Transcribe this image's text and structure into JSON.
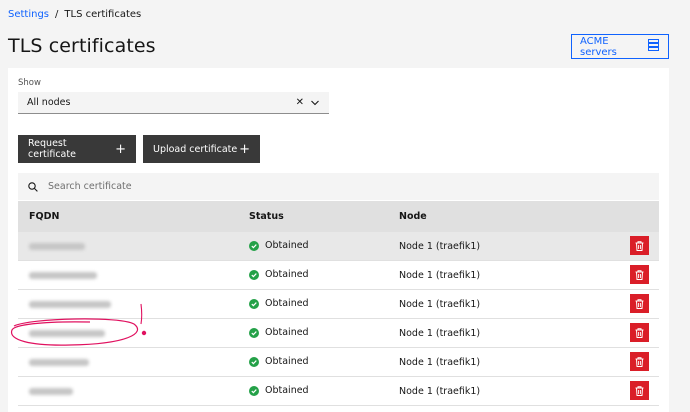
{
  "breadcrumb": {
    "parent": "Settings",
    "separator": "/",
    "current": "TLS certificates"
  },
  "page": {
    "title": "TLS certificates"
  },
  "acme": {
    "label": "ACME servers",
    "icon": "server-list-icon"
  },
  "filter": {
    "label": "Show",
    "value": "All nodes",
    "clear_icon": "close-icon",
    "chevron_icon": "chevron-down-icon"
  },
  "actions": {
    "request_label": "Request certificate",
    "upload_label": "Upload certificate",
    "plus_glyph": "+"
  },
  "search": {
    "placeholder": "Search certificate",
    "icon": "search-icon"
  },
  "table": {
    "headers": {
      "fqdn": "FQDN",
      "status": "Status",
      "node": "Node"
    },
    "rows": [
      {
        "fqdn": "",
        "status": "Obtained",
        "node": "Node 1 (traefik1)"
      },
      {
        "fqdn": "",
        "status": "Obtained",
        "node": "Node 1 (traefik1)"
      },
      {
        "fqdn": "",
        "status": "Obtained",
        "node": "Node 1 (traefik1)"
      },
      {
        "fqdn": "",
        "status": "Obtained",
        "node": "Node 1 (traefik1)"
      },
      {
        "fqdn": "",
        "status": "Obtained",
        "node": "Node 1 (traefik1)"
      },
      {
        "fqdn": "",
        "status": "Obtained",
        "node": "Node 1 (traefik1)"
      }
    ]
  },
  "colors": {
    "link": "#0f62fe",
    "button_dark": "#393939",
    "danger": "#da1e28",
    "success": "#24a148",
    "annotation": "#e0115f"
  }
}
